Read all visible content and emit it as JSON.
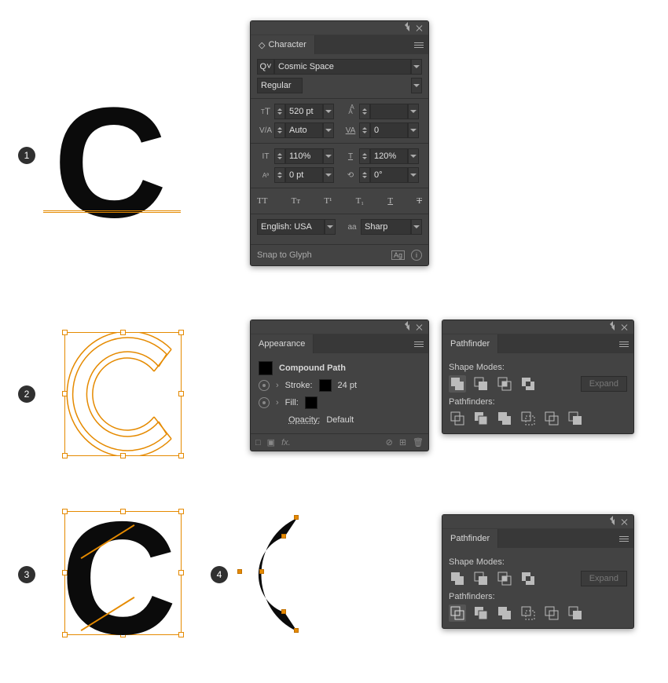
{
  "steps": {
    "s1": "1",
    "s2": "2",
    "s3": "3",
    "s4": "4"
  },
  "glyph": "C",
  "character_panel": {
    "title": "Character",
    "font_family": "Cosmic Space",
    "font_style": "Regular",
    "font_size": "520 pt",
    "leading": "",
    "kerning": "Auto",
    "tracking": "0",
    "vertical_scale": "110%",
    "horizontal_scale": "120%",
    "baseline_shift": "0 pt",
    "rotation": "0°",
    "language": "English: USA",
    "antialias_label": "aa",
    "antialias": "Sharp",
    "footer": "Snap to Glyph"
  },
  "appearance_panel": {
    "title": "Appearance",
    "object_type": "Compound Path",
    "stroke_label": "Stroke:",
    "stroke_value": "24 pt",
    "fill_label": "Fill:",
    "opacity_label": "Opacity:",
    "opacity_value": "Default"
  },
  "pathfinder_panel": {
    "title": "Pathfinder",
    "shape_modes_label": "Shape Modes:",
    "pathfinders_label": "Pathfinders:",
    "expand_label": "Expand"
  }
}
